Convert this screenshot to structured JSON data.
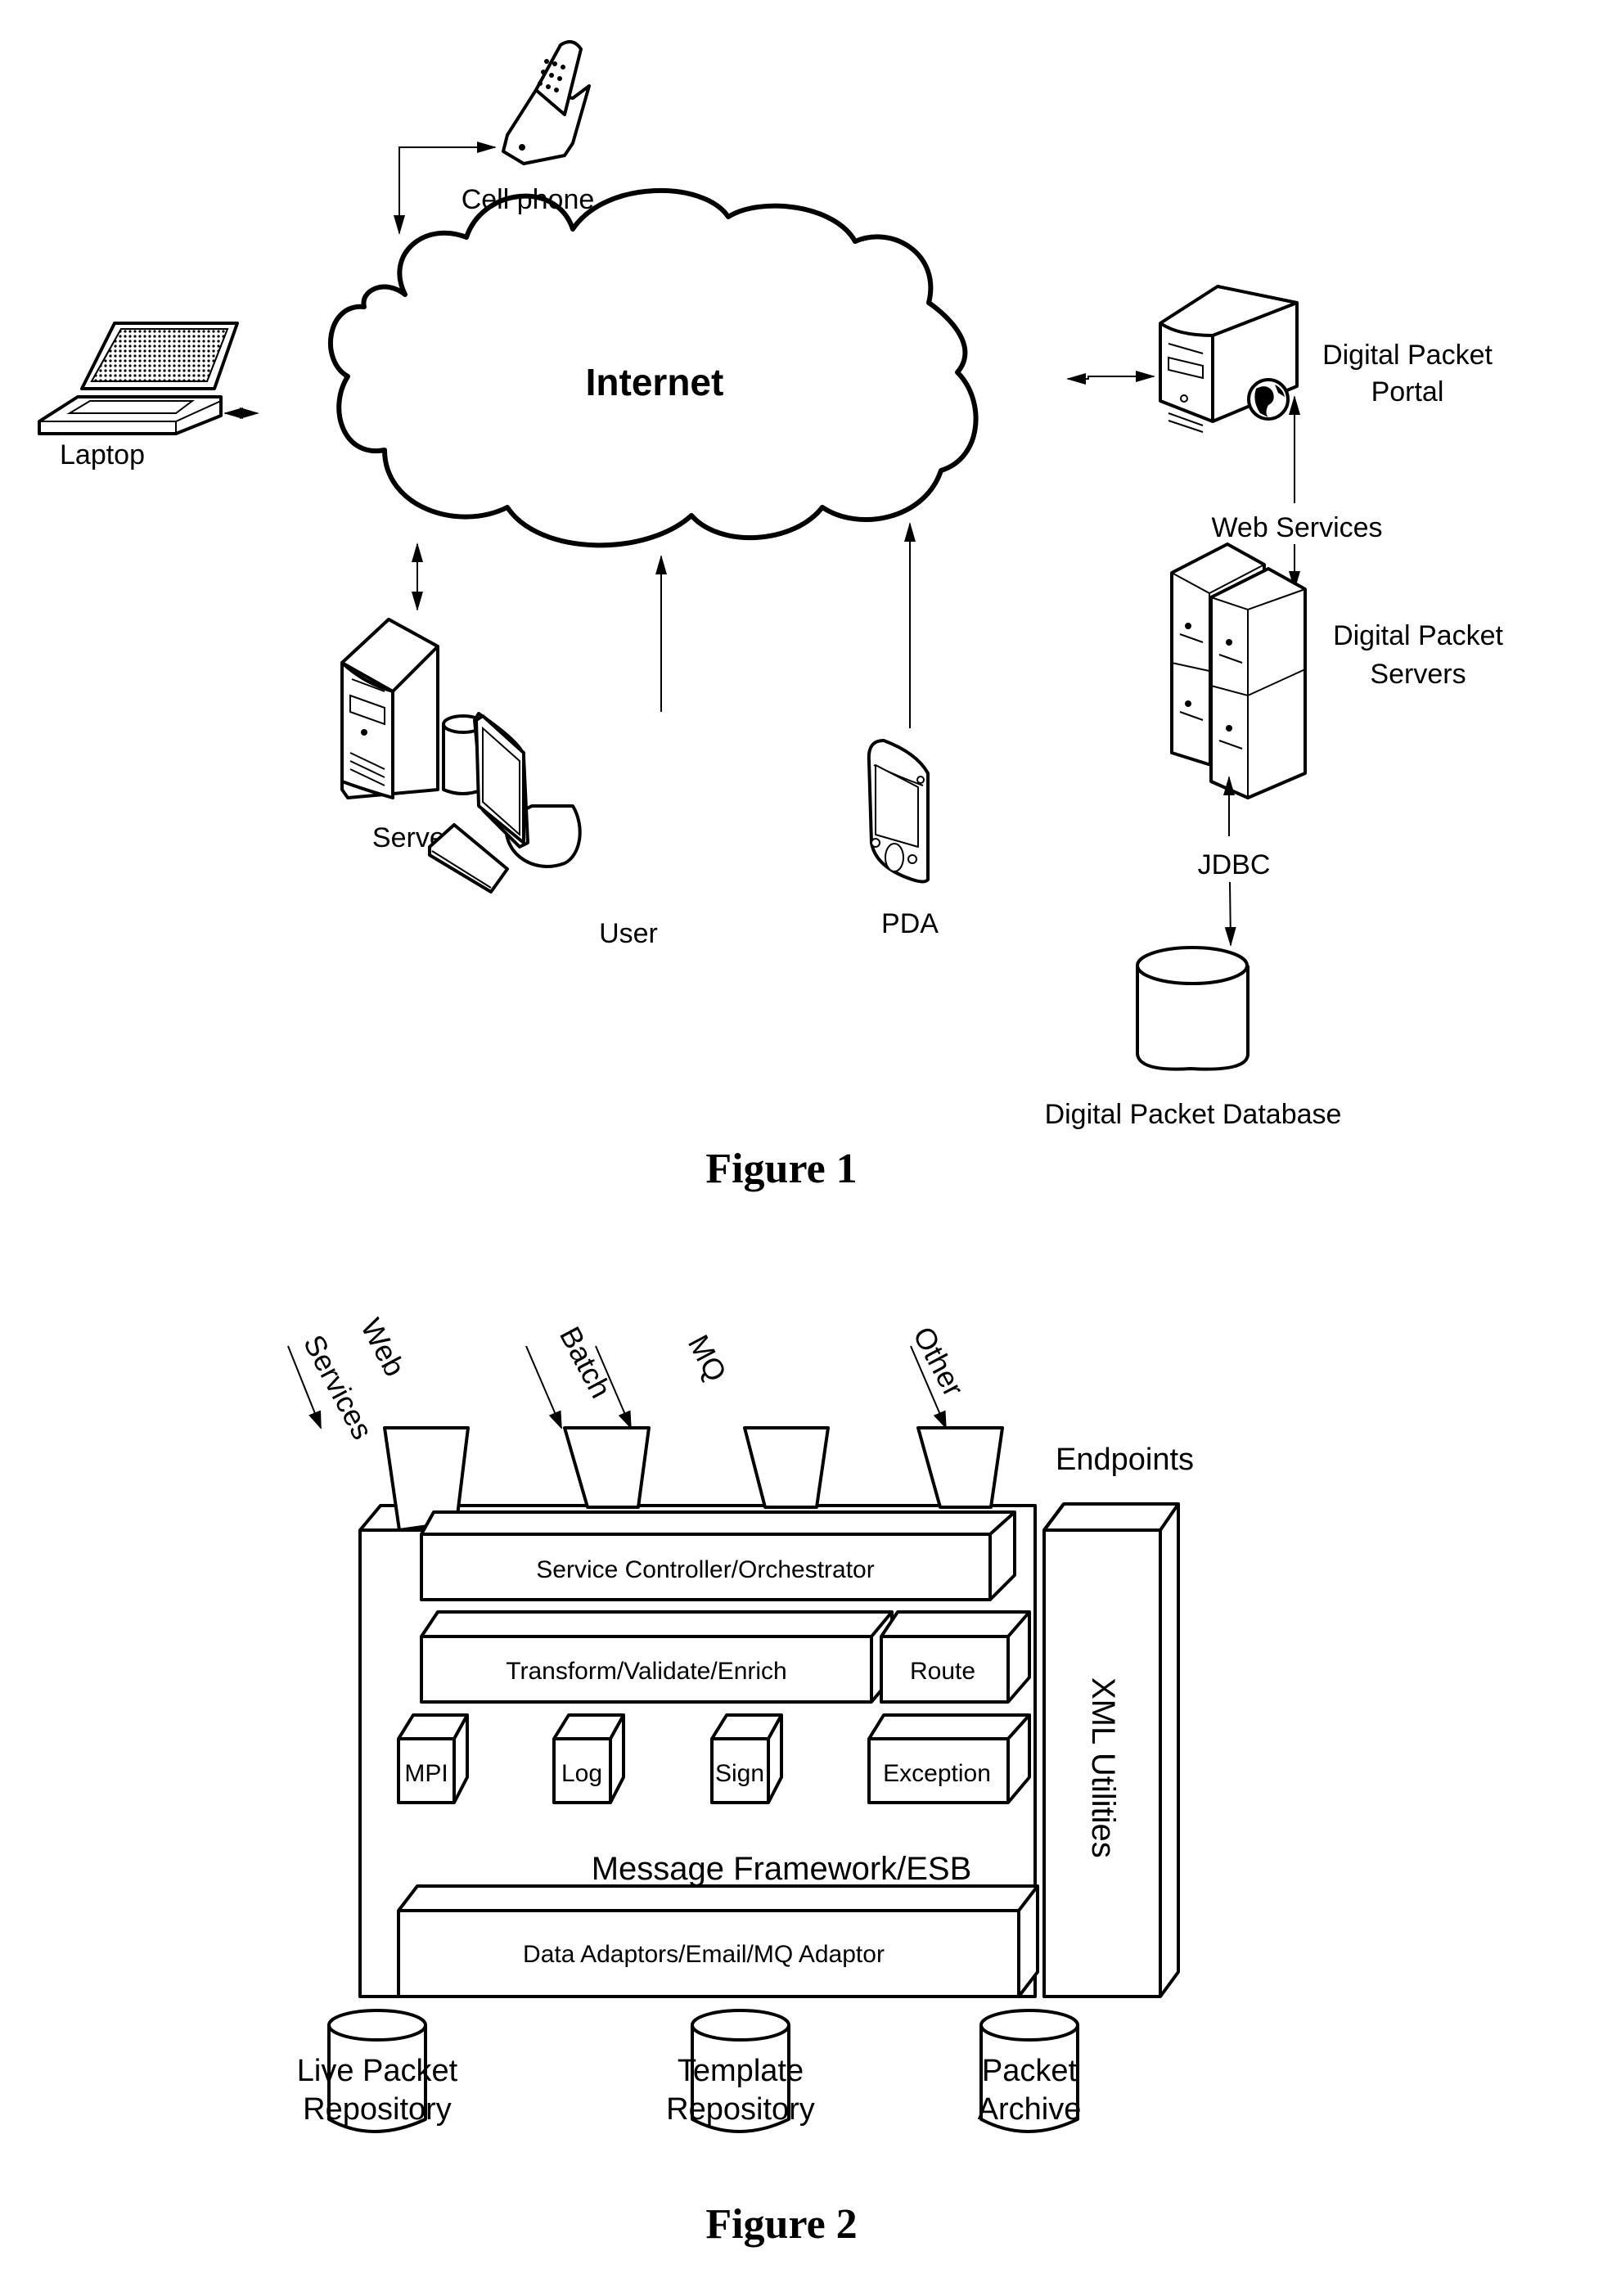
{
  "figure1": {
    "caption": "Figure 1",
    "cloud_label": "Internet",
    "nodes": {
      "cell_phone": "Cell phone",
      "laptop": "Laptop",
      "server": "Server",
      "user": "User",
      "pda": "PDA",
      "portal_line1": "Digital Packet",
      "portal_line2": "Portal",
      "servers_line1": "Digital Packet",
      "servers_line2": "Servers",
      "database": "Digital Packet Database"
    },
    "connections": {
      "web_services": "Web Services",
      "jdbc": "JDBC"
    }
  },
  "figure2": {
    "caption": "Figure 2",
    "endpoints_label": "Endpoints",
    "inputs": {
      "web": "Web",
      "services": "Services",
      "batch": "Batch",
      "mq": "MQ",
      "other": "Other"
    },
    "layers": {
      "service_controller": "Service Controller/Orchestrator",
      "transform": "Transform/Validate/Enrich",
      "route": "Route",
      "mpi": "MPI",
      "log": "Log",
      "sign": "Sign",
      "exception": "Exception",
      "message_framework": "Message Framework/ESB",
      "data_adaptors": "Data Adaptors/Email/MQ Adaptor",
      "xml_utilities": "XML Utilities"
    },
    "repositories": {
      "live_line1": "Live Packet",
      "live_line2": "Repository",
      "template_line1": "Template",
      "template_line2": "Repository",
      "archive_line1": "Packet",
      "archive_line2": "Archive"
    }
  }
}
